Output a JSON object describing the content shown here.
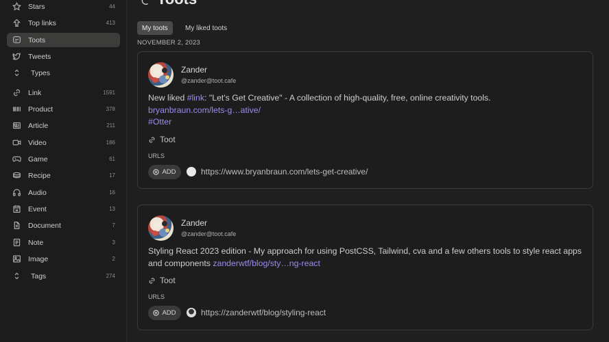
{
  "sidebar": {
    "items": [
      {
        "label": "Stars",
        "count": "44",
        "icon": "star-icon"
      },
      {
        "label": "Top links",
        "count": "413",
        "icon": "top-links-icon"
      },
      {
        "label": "Toots",
        "count": "",
        "icon": "toot-icon",
        "active": true
      },
      {
        "label": "Tweets",
        "count": "",
        "icon": "bird-icon"
      },
      {
        "label": "Types",
        "count": "",
        "icon": "chevron-updown-icon"
      },
      {
        "label": "Link",
        "count": "1591",
        "icon": "link-icon"
      },
      {
        "label": "Product",
        "count": "378",
        "icon": "product-icon"
      },
      {
        "label": "Article",
        "count": "211",
        "icon": "article-icon"
      },
      {
        "label": "Video",
        "count": "186",
        "icon": "video-icon"
      },
      {
        "label": "Game",
        "count": "61",
        "icon": "gamepad-icon"
      },
      {
        "label": "Recipe",
        "count": "17",
        "icon": "recipe-icon"
      },
      {
        "label": "Audio",
        "count": "16",
        "icon": "headphones-icon"
      },
      {
        "label": "Event",
        "count": "13",
        "icon": "calendar-icon"
      },
      {
        "label": "Document",
        "count": "7",
        "icon": "document-icon"
      },
      {
        "label": "Note",
        "count": "3",
        "icon": "note-icon"
      },
      {
        "label": "Image",
        "count": "2",
        "icon": "image-icon"
      },
      {
        "label": "Tags",
        "count": "274",
        "icon": "chevron-updown-icon"
      }
    ]
  },
  "main": {
    "title": "Toots",
    "tabs": [
      "My toots",
      "My liked toots"
    ],
    "date": "NOVEMBER 2, 2023",
    "cards": [
      {
        "author": "Zander",
        "handle": "@zander@toot.cafe",
        "text_before": "New liked ",
        "hashtag_link": "#link",
        "text_after": ": \"Let's Get Creative\" - A collection of high-quality, free, online creativity tools.",
        "short_link": "bryanbraun.com/lets-g…ative/",
        "hashtag_otter": "#Otter",
        "type_label": "Toot",
        "urls_label": "URLS",
        "add_label": "ADD",
        "url": "https://www.bryanbraun.com/lets-get-creative/"
      },
      {
        "author": "Zander",
        "handle": "@zander@toot.cafe",
        "text": "Styling React 2023 edition - My approach for using PostCSS, Tailwind, cva and a few others tools to style react apps and components ",
        "short_link": "zanderwtf/blog/sty…ng-react",
        "type_label": "Toot",
        "urls_label": "URLS",
        "add_label": "ADD",
        "url": "https://zanderwtf/blog/styling-react"
      }
    ]
  },
  "colors": {
    "accent_link": "#9d8cf0",
    "active_bg": "#3c3c3a"
  }
}
